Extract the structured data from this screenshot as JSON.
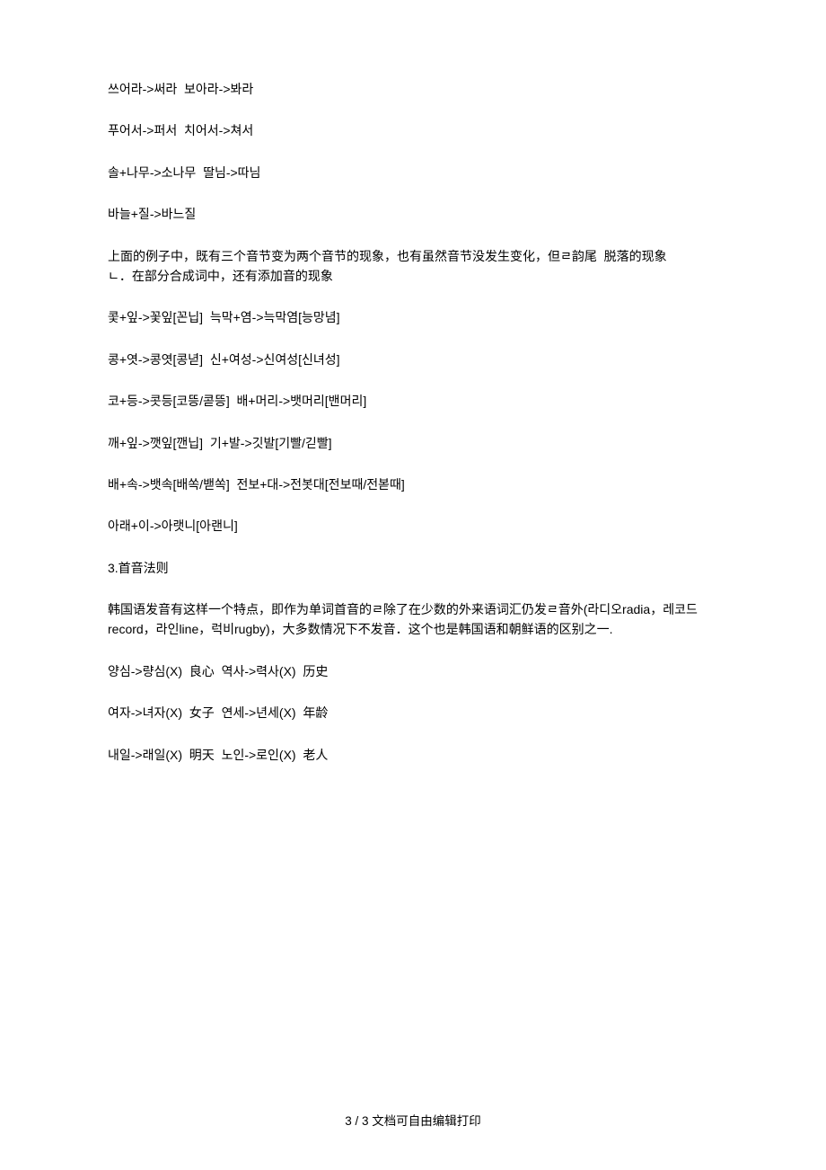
{
  "paragraphs": [
    "쓰어라->써라  보아라->봐라",
    "푸어서->퍼서  치어서->쳐서",
    "솔+나무->소나무  딸님->따님",
    "바늘+질->바느질",
    "上面的例子中，既有三个音节变为两个音节的现象，也有虽然音节没发生变化，但ㄹ韵尾  脱落的现象\nㄴ．在部分合成词中，还有添加音的现象",
    "",
    "콫+잎->꽃잎[꼰닙]  늑막+염->늑막염[능망념]",
    "콩+엿->콩엿[콩녇]  신+여성->신여성[신녀성]",
    "코+등->콧등[코뜽/콛뜽]  배+머리->뱃머리[밴머리]",
    "깨+잎->깻잎[깬닙]  기+발->깃발[기빨/긷빨]",
    "배+속->뱃속[배쏙/밷쏙]  전보+대->전봇대[전보때/전볻때]",
    "아래+이->아랫니[아랜니]",
    "3.首音法则",
    "韩国语发音有这样一个特点，即作为单词首音的ㄹ除了在少数的外来语词汇仍发ㄹ音外(라디오radia，레코드record，라인line，럭비rugby)，大多数情况下不发音．这个也是韩国语和朝鲜语的区别之一.",
    "양심->량심(X)  良心  역사->력사(X)  历史",
    "여자->녀자(X)  女子  연세->년세(X)  年龄",
    "내일->래일(X)  明天  노인->로인(X)  老人"
  ],
  "footer": "3 / 3 文档可自由编辑打印"
}
